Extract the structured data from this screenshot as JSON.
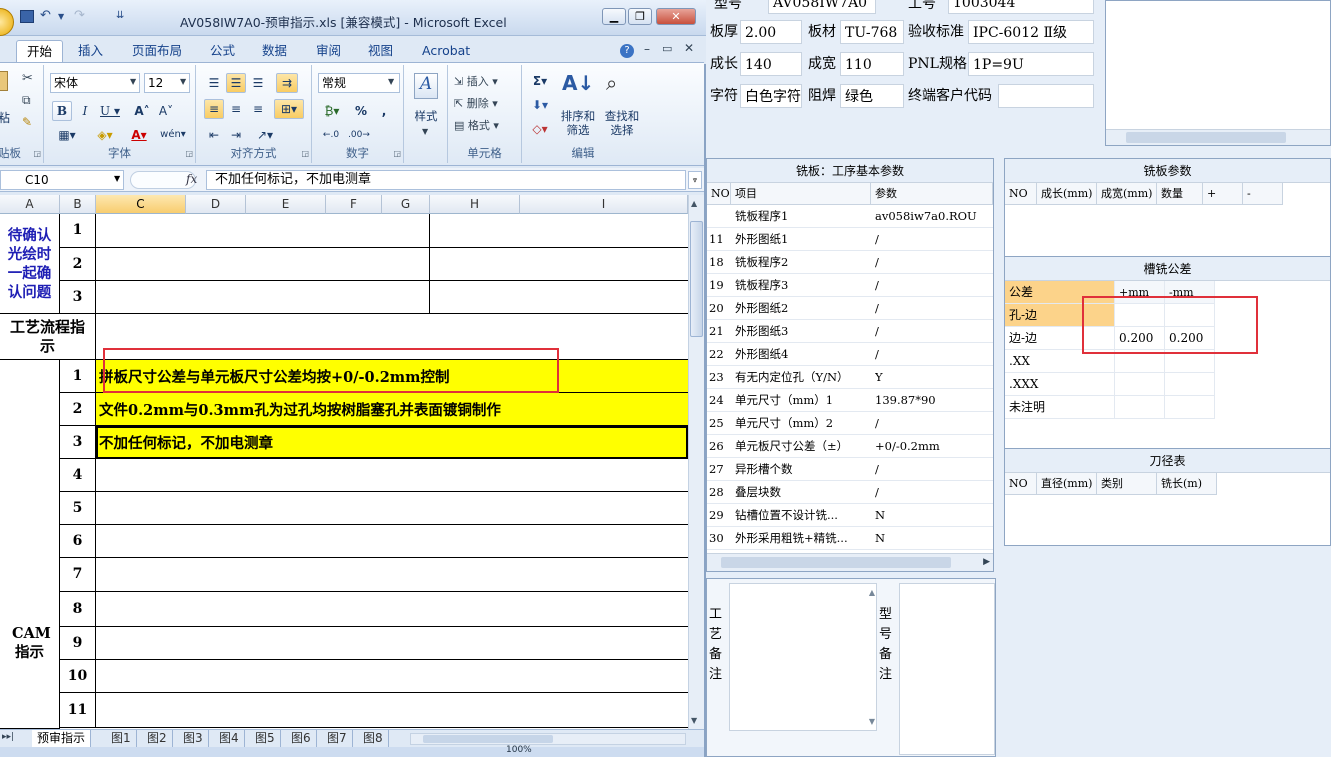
{
  "window": {
    "title": "AV058IW7A0-预审指示.xls  [兼容模式] - Microsoft Excel"
  },
  "ribbon": {
    "tabs": [
      "开始",
      "插入",
      "页面布局",
      "公式",
      "数据",
      "审阅",
      "视图",
      "Acrobat"
    ],
    "active_tab": "开始",
    "groups": {
      "clipboard": "贴板",
      "paste": "粘",
      "font": "字体",
      "alignment": "对齐方式",
      "number": "数字",
      "cells": "单元格",
      "editing": "编辑"
    },
    "font_name": "宋体",
    "font_size": "12",
    "number_format": "常规",
    "styles_label": "样式",
    "insert_label": "插入",
    "delete_label": "删除",
    "format_label": "格式",
    "sort_filter_label": "排序和筛选",
    "find_select_label": "查找和选择"
  },
  "formula_bar": {
    "name_box": "C10",
    "fx": "fx",
    "content": "不加任何标记，不加电测章"
  },
  "columns": [
    "A",
    "B",
    "C",
    "D",
    "E",
    "F",
    "G",
    "H",
    "I"
  ],
  "sheet": {
    "confirm_label": "待确认光绘时一起确认问题",
    "confirm_rows": [
      "1",
      "2",
      "3"
    ],
    "process_label": "工艺流程指示",
    "cam_label": "CAM指示",
    "cam_rows": [
      {
        "n": "1",
        "text": "拼板尺寸公差与单元板尺寸公差均按+0/-0.2mm控制"
      },
      {
        "n": "2",
        "text": "文件0.2mm与0.3mm孔为过孔均按树脂塞孔并表面镀铜制作"
      },
      {
        "n": "3",
        "text": "不加任何标记，不加电测章"
      },
      {
        "n": "4",
        "text": ""
      },
      {
        "n": "5",
        "text": ""
      },
      {
        "n": "6",
        "text": ""
      },
      {
        "n": "7",
        "text": ""
      },
      {
        "n": "8",
        "text": ""
      },
      {
        "n": "9",
        "text": ""
      },
      {
        "n": "10",
        "text": ""
      },
      {
        "n": "11",
        "text": ""
      }
    ]
  },
  "sheet_tabs": [
    "预审指示",
    "图1",
    "图2",
    "图3",
    "图4",
    "图5",
    "图6",
    "图7",
    "图8"
  ],
  "active_sheet": "预审指示",
  "status": {
    "zoom": "100%"
  },
  "right_app": {
    "top_partial": {
      "model_label": "型号",
      "model_value": "AV058IW7A0",
      "order_label": "工号",
      "order_value": "1003044"
    },
    "fields_row1": [
      {
        "label": "板厚",
        "value": "2.00"
      },
      {
        "label": "板材",
        "value": "TU-768"
      },
      {
        "label": "验收标准",
        "value": "IPC-6012 Ⅱ级"
      }
    ],
    "fields_row2": [
      {
        "label": "成长",
        "value": "140"
      },
      {
        "label": "成宽",
        "value": "110"
      },
      {
        "label": "PNL规格",
        "value": "1P=9U"
      }
    ],
    "fields_row3": [
      {
        "label": "字符",
        "value": "白色字符"
      },
      {
        "label": "阻焊",
        "value": "绿色"
      },
      {
        "label": "终端客户代码",
        "value": ""
      }
    ],
    "milling_params": {
      "title": "铣板：工序基本参数",
      "headers": [
        "NO",
        "项目",
        "参数"
      ],
      "rows": [
        {
          "no": "",
          "item": "铣板程序1",
          "value": "av058iw7a0.ROU"
        },
        {
          "no": "11",
          "item": "外形图纸1",
          "value": "/"
        },
        {
          "no": "18",
          "item": "铣板程序2",
          "value": "/"
        },
        {
          "no": "19",
          "item": "铣板程序3",
          "value": "/"
        },
        {
          "no": "20",
          "item": "外形图纸2",
          "value": "/"
        },
        {
          "no": "21",
          "item": "外形图纸3",
          "value": "/"
        },
        {
          "no": "22",
          "item": "外形图纸4",
          "value": "/"
        },
        {
          "no": "23",
          "item": "有无内定位孔（Y/N）",
          "value": "Y"
        },
        {
          "no": "24",
          "item": "单元尺寸（mm）1",
          "value": "139.87*90"
        },
        {
          "no": "25",
          "item": "单元尺寸（mm）2",
          "value": "/"
        },
        {
          "no": "26",
          "item": "单元板尺寸公差（±）",
          "value": "+0/-0.2mm"
        },
        {
          "no": "27",
          "item": "异形槽个数",
          "value": "/"
        },
        {
          "no": "28",
          "item": "叠层块数",
          "value": "/"
        },
        {
          "no": "29",
          "item": "钻槽位置不设计铣...",
          "value": "N"
        },
        {
          "no": "30",
          "item": "外形采用粗铣+精铣...",
          "value": "N"
        }
      ]
    },
    "plate_params": {
      "title": "铣板参数",
      "headers": [
        "NO",
        "成长(mm)",
        "成宽(mm)",
        "数量",
        "+",
        "-"
      ]
    },
    "slot_tolerance": {
      "title": "槽铣公差",
      "headers": [
        "公差",
        "+mm",
        "-mm"
      ],
      "rows": [
        {
          "name": "孔-边",
          "plus": "",
          "minus": ""
        },
        {
          "name": "边-边",
          "plus": "0.200",
          "minus": "0.200"
        },
        {
          "name": ".XX",
          "plus": "",
          "minus": ""
        },
        {
          "name": ".XXX",
          "plus": "",
          "minus": ""
        },
        {
          "name": "未注明",
          "plus": "",
          "minus": ""
        }
      ]
    },
    "tool_table": {
      "title": "刀径表",
      "headers": [
        "NO",
        "直径(mm)",
        "类别",
        "铣长(m)"
      ]
    },
    "process_note_label": "工艺备注",
    "model_note_label": "型号备注"
  }
}
